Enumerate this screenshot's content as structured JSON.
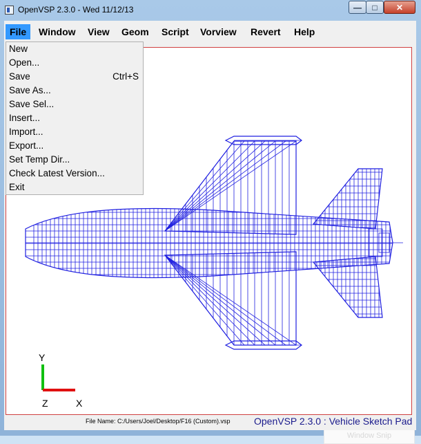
{
  "window": {
    "title": "OpenVSP 2.3.0 - Wed 11/12/13"
  },
  "menubar": {
    "items": [
      {
        "label": "File"
      },
      {
        "label": "Window"
      },
      {
        "label": "View"
      },
      {
        "label": "Geom"
      },
      {
        "label": "Script"
      },
      {
        "label": "Vorview"
      },
      {
        "label": "Revert"
      },
      {
        "label": "Help"
      }
    ]
  },
  "file_menu": {
    "items": [
      {
        "label": "New",
        "shortcut": ""
      },
      {
        "label": "Open...",
        "shortcut": ""
      },
      {
        "label": "Save",
        "shortcut": "Ctrl+S"
      },
      {
        "label": "Save As...",
        "shortcut": ""
      },
      {
        "label": "Save Sel...",
        "shortcut": ""
      },
      {
        "label": "Insert...",
        "shortcut": ""
      },
      {
        "label": "Import...",
        "shortcut": ""
      },
      {
        "label": "Export...",
        "shortcut": ""
      },
      {
        "label": "Set Temp Dir...",
        "shortcut": ""
      },
      {
        "label": "Check Latest Version...",
        "shortcut": ""
      },
      {
        "label": "Exit",
        "shortcut": ""
      }
    ]
  },
  "axes": {
    "y": "Y",
    "z": "Z",
    "x": "X"
  },
  "status": {
    "filename": "File Name: C:/Users/Joel/Desktop/F16 (Custom).vsp",
    "app": "OpenVSP 2.3.0 : Vehicle Sketch Pad"
  },
  "overlay": {
    "snip": "Window Snip"
  },
  "colors": {
    "wireframe": "#1f1fe0",
    "axis_x": "#e01010",
    "axis_y": "#10c010",
    "menu_highlight": "#3399ff"
  }
}
